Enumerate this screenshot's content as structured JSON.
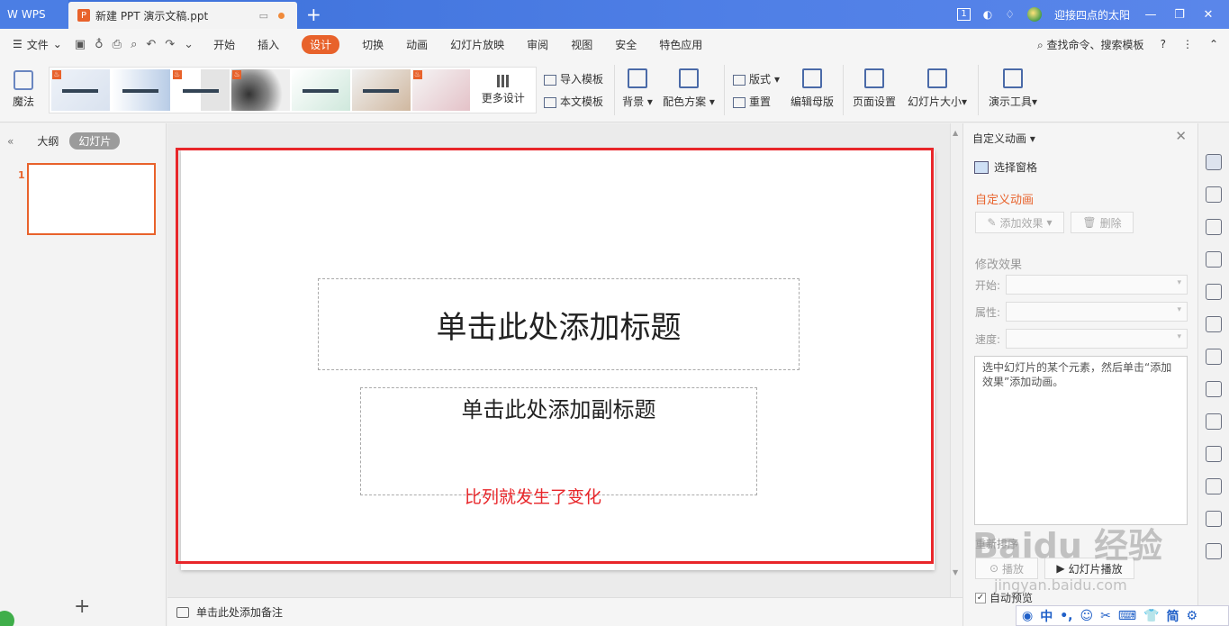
{
  "titlebar": {
    "wps_label": "WPS",
    "doc_tab": "新建 PPT 演示文稿.ppt",
    "user_name": "迎接四点的太阳",
    "badge": "1"
  },
  "menubar": {
    "file": "文件",
    "tabs": [
      "开始",
      "插入",
      "设计",
      "切换",
      "动画",
      "幻灯片放映",
      "审阅",
      "视图",
      "安全",
      "特色应用"
    ],
    "active_tab": "设计",
    "search": "查找命令、搜索模板"
  },
  "ribbon": {
    "magic": "魔法",
    "more_design": "更多设计",
    "import_template": "导入模板",
    "this_template": "本文模板",
    "background": "背景",
    "color_scheme": "配色方案",
    "layout": "版式",
    "reset": "重置",
    "edit_master": "编辑母版",
    "page_setup": "页面设置",
    "slide_size": "幻灯片大小",
    "presentation_tools": "演示工具"
  },
  "leftpanel": {
    "outline": "大纲",
    "slides": "幻灯片",
    "slide_number": "1"
  },
  "slide": {
    "title_placeholder": "单击此处添加标题",
    "subtitle_placeholder": "单击此处添加副标题",
    "annotation": "比列就发生了变化"
  },
  "notes": {
    "placeholder": "单击此处添加备注"
  },
  "rightpanel": {
    "header": "自定义动画",
    "select_pane": "选择窗格",
    "title": "自定义动画",
    "add_effect": "添加效果",
    "delete": "删除",
    "modify_effect": "修改效果",
    "start_label": "开始:",
    "property_label": "属性:",
    "speed_label": "速度:",
    "hint": "选中幻灯片的某个元素，然后单击“添加效果”添加动画。",
    "reorder": "重新排序",
    "play": "播放",
    "slideshow": "幻灯片播放",
    "auto_preview": "自动预览"
  },
  "ime": {
    "items": [
      "中",
      "•,",
      "☺",
      "✂",
      "⌨",
      "👕",
      "简",
      "⚙"
    ]
  },
  "watermark": {
    "text": "Baidu 经验",
    "url": "jingyan.baidu.com"
  },
  "colors": {
    "accent": "#e8622b",
    "titlebar": "#4b7ee4",
    "highlight_box": "#e8262a"
  }
}
